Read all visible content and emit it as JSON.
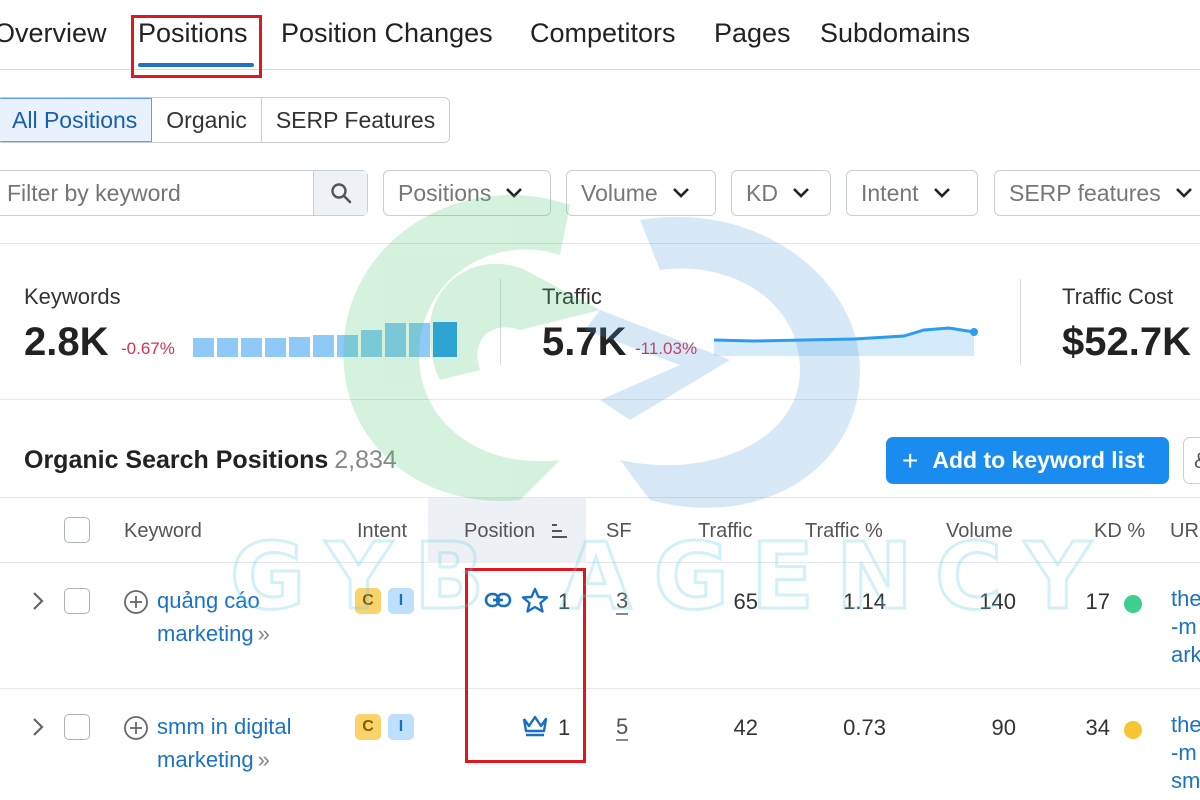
{
  "nav": {
    "tabs": [
      "Overview",
      "Positions",
      "Position Changes",
      "Competitors",
      "Pages",
      "Subdomains"
    ],
    "active": "Positions"
  },
  "segments": [
    "All Positions",
    "Organic",
    "SERP Features"
  ],
  "filters": {
    "search_placeholder": "Filter by keyword",
    "dropdowns": [
      "Positions",
      "Volume",
      "KD",
      "Intent",
      "SERP features"
    ]
  },
  "summary": {
    "keywords": {
      "label": "Keywords",
      "value": "2.8K",
      "delta": "-0.67%"
    },
    "traffic": {
      "label": "Traffic",
      "value": "5.7K",
      "delta": "-11.03%"
    },
    "traffic_cost": {
      "label": "Traffic Cost",
      "value": "$52.7K"
    }
  },
  "section": {
    "title": "Organic Search Positions",
    "count": "2,834",
    "add_button": "Add to keyword list",
    "more_button": "&"
  },
  "table": {
    "headers": [
      "Keyword",
      "Intent",
      "Position",
      "SF",
      "Traffic",
      "Traffic %",
      "Volume",
      "KD %",
      "URL"
    ],
    "rows": [
      {
        "keyword_line1": "quảng cáo",
        "keyword_line2": "marketing",
        "intent": [
          "C",
          "I"
        ],
        "position": "1",
        "sf": "3",
        "traffic": "65",
        "traffic_pct": "1.14",
        "volume": "140",
        "kd": "17",
        "kd_color": "#3ccf8e",
        "url_lines": [
          "the",
          "-m",
          "ark"
        ]
      },
      {
        "keyword_line1": "smm in digital",
        "keyword_line2": "marketing",
        "intent": [
          "C",
          "I"
        ],
        "position": "1",
        "sf": "5",
        "traffic": "42",
        "traffic_pct": "0.73",
        "volume": "90",
        "kd": "34",
        "kd_color": "#f7c432",
        "url_lines": [
          "the",
          "-m",
          "sm"
        ]
      }
    ]
  },
  "watermark": {
    "text": "GYB AGENCY"
  },
  "colors": {
    "accent": "#1a8cf0",
    "highlight": "#e0171d",
    "negative": "#d9304f"
  }
}
